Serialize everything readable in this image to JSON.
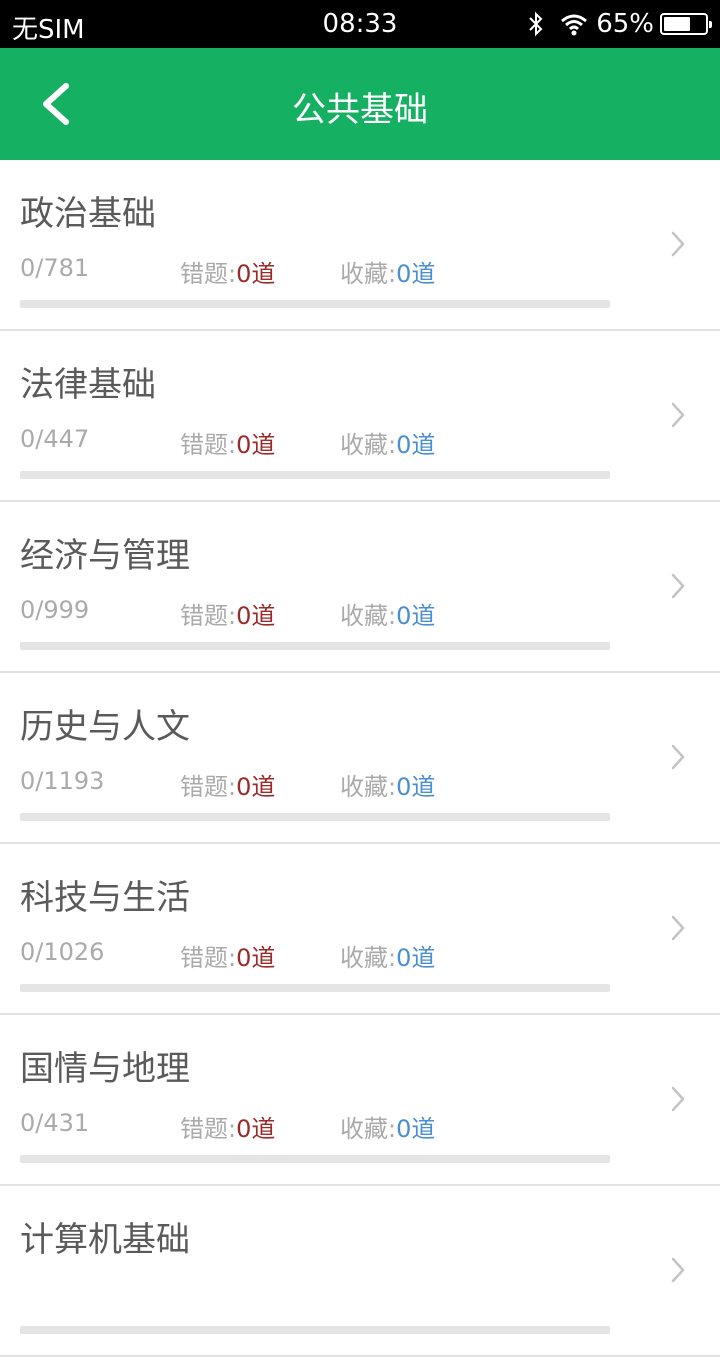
{
  "status": {
    "carrier": "无SIM",
    "time": "08:33",
    "battery_text": "65%",
    "battery_level": 0.65
  },
  "nav": {
    "title": "公共基础",
    "back_icon": "chevron-left-icon"
  },
  "labels": {
    "wrong_prefix": "错题:",
    "fav_prefix": "收藏:"
  },
  "categories": [
    {
      "name": "政治基础",
      "count": "0/781",
      "wrong": "0道",
      "fav": "0道",
      "progress": 0
    },
    {
      "name": "法律基础",
      "count": "0/447",
      "wrong": "0道",
      "fav": "0道",
      "progress": 0
    },
    {
      "name": "经济与管理",
      "count": "0/999",
      "wrong": "0道",
      "fav": "0道",
      "progress": 0
    },
    {
      "name": "历史与人文",
      "count": "0/1193",
      "wrong": "0道",
      "fav": "0道",
      "progress": 0
    },
    {
      "name": "科技与生活",
      "count": "0/1026",
      "wrong": "0道",
      "fav": "0道",
      "progress": 0
    },
    {
      "name": "国情与地理",
      "count": "0/431",
      "wrong": "0道",
      "fav": "0道",
      "progress": 0
    },
    {
      "name": "计算机基础",
      "count": "",
      "wrong": "",
      "fav": "",
      "progress": 0
    }
  ],
  "colors": {
    "accent": "#16b062",
    "wrong": "#9b2a2a",
    "fav": "#4a8fd0"
  }
}
